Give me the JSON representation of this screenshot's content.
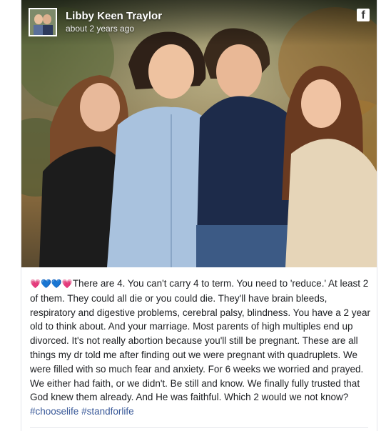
{
  "post": {
    "author": "Libby Keen Traylor",
    "timestamp": "about 2 years ago",
    "platform_icon": "facebook-icon",
    "emojis": [
      "💗",
      "💙",
      "💙",
      "💗"
    ],
    "caption": "There are 4. You can't carry 4 to term. You need to 'reduce.' At least 2 of them. They could all die or you could die. They'll have brain bleeds, respiratory and digestive problems, cerebral palsy, blindness. You have a 2 year old to think about. And your marriage. Most parents of high multiples end up divorced. It's not really abortion because you'll still be pregnant. These are all things my dr told me after finding out we were pregnant with quadruplets. We were filled with so much fear and anxiety. For 6 weeks we worried and prayed. We either had faith, or we didn't. Be still and know. We finally fully trusted that God knew them already. And He was faithful. Which 2 would we not know?",
    "hashtags": [
      "#chooselife",
      "#standforlife"
    ]
  },
  "colors": {
    "hashtag": "#385898",
    "text": "#1c1e21",
    "heart_pink": "#e0245e",
    "heart_blue": "#2d9fe3"
  }
}
